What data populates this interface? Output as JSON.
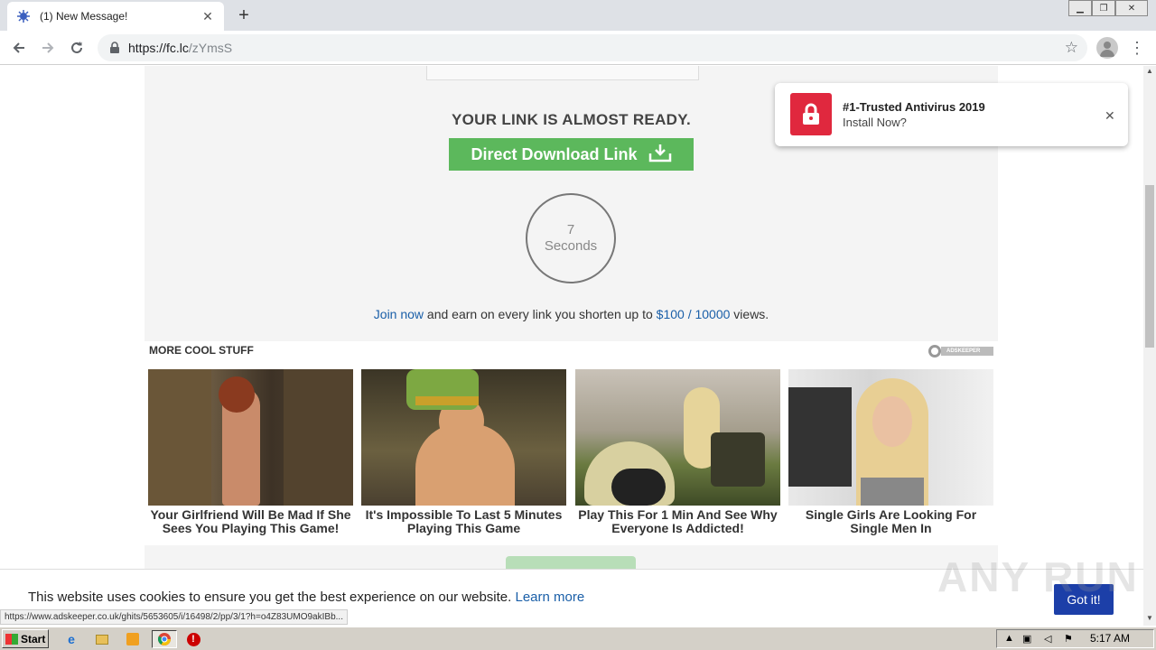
{
  "browser": {
    "tab_title": "(1) New Message!",
    "url_host": "https://fc.lc",
    "url_path": "/zYmsS"
  },
  "page": {
    "headline": "YOUR LINK IS ALMOST READY.",
    "download_label": "Direct Download Link",
    "timer_value": "7",
    "timer_unit": "Seconds",
    "earn_link1": "Join now",
    "earn_mid": " and earn on every link you shorten up to ",
    "earn_link2": "$100 / 10000",
    "earn_end": " views.",
    "more_title": "MORE COOL STUFF",
    "adskeeper_label": "ADSKEEPER",
    "ads": [
      {
        "title": "Your Girlfriend Will Be Mad If She Sees You Playing This Game!"
      },
      {
        "title": "It's Impossible To Last 5 Minutes Playing This Game"
      },
      {
        "title": "Play This For 1 Min And See Why Everyone Is Addicted!"
      },
      {
        "title": "Single Girls Are Looking For Single Men In"
      }
    ]
  },
  "notification": {
    "title": "#1-Trusted Antivirus 2019",
    "subtitle": "Install Now?"
  },
  "cookie": {
    "text": "This website uses cookies to ensure you get the best experience on our website.",
    "link": "Learn more",
    "button": "Got it!"
  },
  "status_url": "https://www.adskeeper.co.uk/ghits/5653605/i/16498/2/pp/3/1?h=o4Z83UMO9akIBb...",
  "watermark": "ANY RUN",
  "taskbar": {
    "start_label": "Start",
    "clock": "5:17 AM"
  },
  "colors": {
    "download_green": "#5cb85c",
    "link_blue": "#1a5fa8",
    "alert_red": "#e0283e",
    "gotit_blue": "#1c3fa8"
  }
}
